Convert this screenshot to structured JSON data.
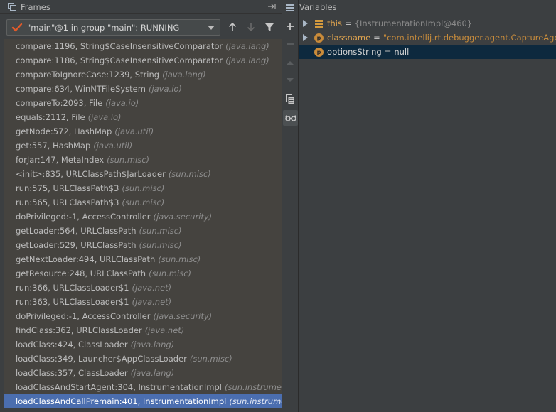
{
  "frames_panel": {
    "title": "Frames",
    "thread": "\"main\"@1 in group \"main\": RUNNING",
    "rows": [
      {
        "method": "compare:1196, String$CaseInsensitiveComparator",
        "pkg": "(java.lang)"
      },
      {
        "method": "compare:1186, String$CaseInsensitiveComparator",
        "pkg": "(java.lang)"
      },
      {
        "method": "compareToIgnoreCase:1239, String",
        "pkg": "(java.lang)"
      },
      {
        "method": "compare:634, WinNTFileSystem",
        "pkg": "(java.io)"
      },
      {
        "method": "compareTo:2093, File",
        "pkg": "(java.io)"
      },
      {
        "method": "equals:2112, File",
        "pkg": "(java.io)"
      },
      {
        "method": "getNode:572, HashMap",
        "pkg": "(java.util)"
      },
      {
        "method": "get:557, HashMap",
        "pkg": "(java.util)"
      },
      {
        "method": "forJar:147, MetaIndex",
        "pkg": "(sun.misc)"
      },
      {
        "method": "<init>:835, URLClassPath$JarLoader",
        "pkg": "(sun.misc)"
      },
      {
        "method": "run:575, URLClassPath$3",
        "pkg": "(sun.misc)"
      },
      {
        "method": "run:565, URLClassPath$3",
        "pkg": "(sun.misc)"
      },
      {
        "method": "doPrivileged:-1, AccessController",
        "pkg": "(java.security)"
      },
      {
        "method": "getLoader:564, URLClassPath",
        "pkg": "(sun.misc)"
      },
      {
        "method": "getLoader:529, URLClassPath",
        "pkg": "(sun.misc)"
      },
      {
        "method": "getNextLoader:494, URLClassPath",
        "pkg": "(sun.misc)"
      },
      {
        "method": "getResource:248, URLClassPath",
        "pkg": "(sun.misc)"
      },
      {
        "method": "run:366, URLClassLoader$1",
        "pkg": "(java.net)"
      },
      {
        "method": "run:363, URLClassLoader$1",
        "pkg": "(java.net)"
      },
      {
        "method": "doPrivileged:-1, AccessController",
        "pkg": "(java.security)"
      },
      {
        "method": "findClass:362, URLClassLoader",
        "pkg": "(java.net)"
      },
      {
        "method": "loadClass:424, ClassLoader",
        "pkg": "(java.lang)"
      },
      {
        "method": "loadClass:349, Launcher$AppClassLoader",
        "pkg": "(sun.misc)"
      },
      {
        "method": "loadClass:357, ClassLoader",
        "pkg": "(java.lang)"
      },
      {
        "method": "loadClassAndStartAgent:304, InstrumentationImpl",
        "pkg": "(sun.instrument)"
      },
      {
        "method": "loadClassAndCallPremain:401, InstrumentationImpl",
        "pkg": "(sun.instrument)",
        "selected": true
      }
    ]
  },
  "variables_panel": {
    "title": "Variables",
    "rows": [
      {
        "name": "this",
        "eq": "=",
        "value": "{InstrumentationImpl@460}",
        "icon": "field-list-icon",
        "expandable": true
      },
      {
        "name": "classname",
        "eq": "=",
        "value": "\"com.intellij.rt.debugger.agent.CaptureAgent\"",
        "icon": "parameter-icon",
        "icon_letter": "p",
        "expandable": true
      },
      {
        "name": "optionsString",
        "eq": "=",
        "value": "null",
        "icon": "parameter-icon",
        "icon_letter": "p",
        "expandable": false,
        "selected": true
      }
    ]
  },
  "colors": {
    "background": "#3c3f41",
    "frame_list_bg": "#45433f",
    "selection": "#4b6eaf",
    "var_selection": "#0d293e",
    "string_value": "#c88c3c"
  }
}
